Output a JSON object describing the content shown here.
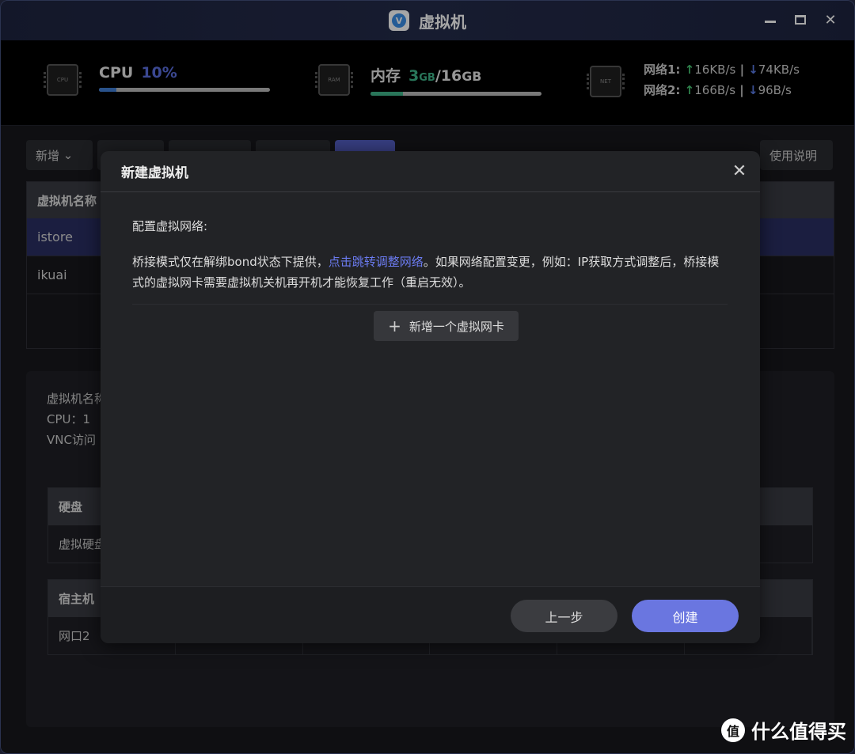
{
  "window": {
    "title": "虚拟机"
  },
  "stats": {
    "cpu": {
      "label": "CPU",
      "value": "10%",
      "percent": 10,
      "icon_text": "CPU"
    },
    "mem": {
      "label": "内存",
      "used": "3",
      "used_unit": "GB",
      "sep": "/",
      "total": "16",
      "total_unit": "GB",
      "percent": 19,
      "icon_text": "RAM"
    },
    "net": {
      "icon_text": "NET",
      "rows": [
        {
          "label": "网络1:",
          "up": "16KB/s",
          "down": "74KB/s"
        },
        {
          "label": "网络2:",
          "up": "166B/s",
          "down": "96B/s"
        }
      ]
    }
  },
  "toolbar": {
    "new_label": "新增",
    "help_label": "使用说明"
  },
  "vm_table": {
    "header": "虚拟机名称",
    "rows": [
      "istore",
      "ikuai"
    ]
  },
  "detail": {
    "name_prefix": "虚拟机名称",
    "cpu_line": "CPU：1",
    "vnc_prefix": "VNC访问",
    "disk_table": {
      "header": "硬盘",
      "row": "虚拟硬盘"
    },
    "host_table": {
      "header": "宿主机",
      "row": "网口2"
    }
  },
  "modal": {
    "title": "新建虚拟机",
    "section_label": "配置虚拟网络:",
    "notice_part1": "桥接模式仅在解绑bond状态下提供，",
    "notice_link": "点击跳转调整网络",
    "notice_part2": "。如果网络配置变更，例如：IP获取方式调整后，桥接模式的虚拟网卡需要虚拟机关机再开机才能恢复工作（重启无效）。",
    "add_nic_label": "新增一个虚拟网卡",
    "prev_label": "上一步",
    "create_label": "创建"
  },
  "watermark": {
    "logo": "值",
    "text": "什么值得买"
  }
}
